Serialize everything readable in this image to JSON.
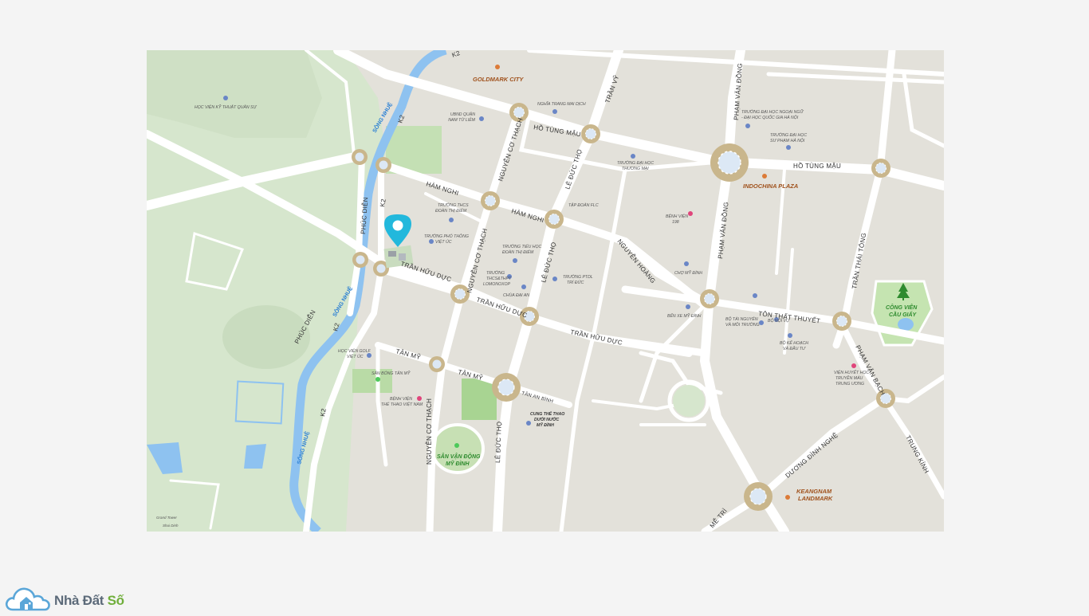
{
  "brand": {
    "name_main": "Nhà Đất",
    "name_accent": "Số"
  },
  "colors": {
    "road": "#ffffff",
    "land": "#e3e1da",
    "green": "#d6e6cd",
    "water": "#8ec2f0",
    "roundabout": "#c9b68c",
    "pin": "#22b8dc",
    "poi_blue": "#6a86c6",
    "poi_pink": "#e0457b",
    "poi_orange": "#dc7b38",
    "poi_green": "#4cc95a"
  },
  "map": {
    "roads": {
      "k2_top": "K2",
      "k2_left": "K2",
      "k2_mid": "K2",
      "k2_bottom": "K2",
      "k2_lower": "K2",
      "ho_tung_mau_1": "HỒ TÙNG MẬU",
      "ho_tung_mau_2": "HỒ TÙNG MẬU",
      "ham_nghi_1": "HÀM NGHI",
      "ham_nghi_2": "HÀM NGHI",
      "nguyen_co_thach_top": "NGUYỄN CƠ THẠCH",
      "nguyen_co_thach_mid": "NGUYỄN CƠ THẠCH",
      "nguyen_co_thach_bottom": "NGUYỄN CƠ THẠCH",
      "le_duc_tho_1": "LÊ ĐỨC THỌ",
      "le_duc_tho_2": "LÊ ĐỨC THỌ",
      "le_duc_tho_3": "LÊ ĐỨC THỌ",
      "tran_vy": "TRẦN VỸ",
      "pham_van_dong_1": "PHẠM VĂN ĐỒNG",
      "pham_van_dong_2": "PHẠM VĂN ĐỒNG",
      "nguyen_hoang": "NGUYỄN HOÀNG",
      "tran_huu_duc_1": "TRẦN HỮU DỰC",
      "tran_huu_duc_2": "TRẦN HỮU DỰC",
      "tran_huu_duc_3": "TRẦN HỮU DỰC",
      "ton_that_thuyet": "TÔN THẤT THUYẾT",
      "tran_thai_tong": "TRẦN THÁI TÔNG",
      "pham_van_bach": "PHẠM VĂN BẠCH",
      "trung_kinh": "TRUNG KÍNH",
      "duong_dinh_nghe": "DƯƠNG ĐÌNH NGHỆ",
      "me_tri": "MỄ TRÌ",
      "phuc_dien_1": "PHÚC DIỄN",
      "phuc_dien_2": "PHÚC DIỄN",
      "tan_my_1": "TÂN MỸ",
      "tan_my_2": "TÂN MỸ",
      "tan_an_binh": "TÂN AN BÌNH",
      "song_nhue_1": "SÔNG NHUỆ",
      "song_nhue_2": "SÔNG NHUỆ",
      "song_nhue_3": "SÔNG NHUỆ"
    },
    "landmarks": {
      "goldmark": "GOLDMARK CITY",
      "indochina": "INDOCHINA PLAZA",
      "keangnam_1": "KEANGNAM",
      "keangnam_2": "LANDMARK"
    },
    "greens": {
      "cong_vien_1": "CÔNG VIÊN",
      "cong_vien_2": "CẦU GIẤY",
      "san_van_dong_1": "SÂN VẬN ĐỘNG",
      "san_van_dong_2": "MỸ ĐÌNH"
    },
    "pois": {
      "hv_ky_thuat": "HỌC VIỆN KỸ THUẬT QUÂN SỰ",
      "ubnd_1": "UBND QUẬN",
      "ubnd_2": "NAM TỪ LIÊM",
      "nghia_trang": "NGHĨA TRANG MAI DỊCH",
      "dh_ngoai_ngu_1": "TRƯỜNG ĐẠI HỌC NGOẠI NGỮ",
      "dh_ngoai_ngu_2": "- ĐẠI HỌC QUỐC GIA HÀ NỘI",
      "dh_su_pham_1": "TRƯỜNG ĐẠI HỌC",
      "dh_su_pham_2": "SƯ PHẠM HÀ NỘI",
      "dh_thuong_mai_1": "TRƯỜNG ĐẠI HỌC",
      "dh_thuong_mai_2": "THƯƠNG MẠI",
      "thcs_doan_1": "TRƯỜNG THCS",
      "thcs_doan_2": "ĐOÀN THỊ ĐIỂM",
      "tap_doan_flc": "TẬP ĐOÀN FLC",
      "benh_vien_198_1": "BỆNH VIỆN",
      "benh_vien_198_2": "198",
      "pho_thong_viet_uc_1": "TRƯỜNG PHỔ THÔNG",
      "pho_thong_viet_uc_2": "VIỆT ÚC",
      "tieu_hoc_doan_1": "TRƯỜNG TIỂU HỌC",
      "tieu_hoc_doan_2": "ĐOÀN THỊ ĐIỂM",
      "lomonoxop_1": "TRƯỜNG",
      "lomonoxop_2": "THCS&THPT",
      "lomonoxop_3": "LOMONOXOP",
      "ptdl_tri_duc_1": "TRƯỜNG PTDL",
      "ptdl_tri_duc_2": "TRÍ ĐỨC",
      "chua_dai_an": "CHÙA ĐẠI AN",
      "cho_my_dinh": "CHỢ MỸ ĐÌNH",
      "ben_xe": "BẾN XE MỸ ĐÌNH",
      "bo_tnmt_1": "BỘ TÀI NGUYÊN",
      "bo_tnmt_2": "VÀ MÔI TRƯỜNG",
      "bo_noi_vu": "BỘ NỘI VỤ",
      "bo_khdt_1": "BỘ KẾ HOẠCH",
      "bo_khdt_2": "VÀ ĐẦU TƯ",
      "vien_huyet_hoc_1": "VIỆN HUYẾT HỌC",
      "vien_huyet_hoc_2": "TRUYỀN MÁU",
      "vien_huyet_hoc_3": "TRUNG ƯƠNG",
      "hv_golf_1": "HỌC VIỆN GOLF",
      "hv_golf_2": "VIỆT ÚC",
      "san_bong": "SÂN BÓNG TÂN MỸ",
      "bv_the_thao_1": "BỆNH VIỆN",
      "bv_the_thao_2": "THỂ THAO VIỆT NAM",
      "cung_the_thao_1": "CUNG THỂ THAO",
      "cung_the_thao_2": "DƯỚI NƯỚC",
      "cung_the_thao_3": "MỸ ĐÌNH",
      "grand_tower": "Grand Tower",
      "shui_dinh": "Shui Dinh"
    }
  }
}
